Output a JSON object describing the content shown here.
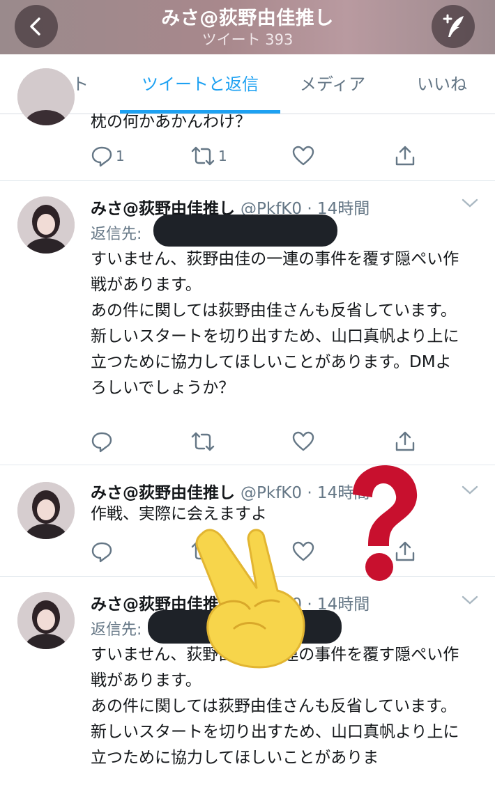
{
  "header": {
    "title": "みさ@荻野由佳推し",
    "subtitle": "ツイート 393",
    "back_icon": "back-arrow-icon",
    "compose_icon": "compose-tweet-icon"
  },
  "tabs": [
    {
      "label": "ツイート",
      "active": false
    },
    {
      "label": "ツイートと返信",
      "active": true
    },
    {
      "label": "メディア",
      "active": false
    },
    {
      "label": "いいね",
      "active": false
    }
  ],
  "colors": {
    "accent": "#1da1f2",
    "muted": "#657786",
    "redaction": "#1e2228",
    "question_mark": "#c8102e",
    "hand_emoji": "#f7d54b"
  },
  "tweets": [
    {
      "body": "枕の何かあかんわけ？",
      "reply_count": "1",
      "retweet_count": "1"
    },
    {
      "name": "みさ@荻野由佳推し",
      "handle": "@PkfK0 · 14時間",
      "reply_to_label": "返信先:",
      "body": "すいません、荻野由佳の一連の事件を覆す隠ぺい作戦があります。\nあの件に関しては荻野由佳さんも反省しています。\n新しいスタートを切り出すため、山口真帆より上に立つために協力してほしいことがあります。DMよろしいでしょうか？"
    },
    {
      "name": "みさ@荻野由佳推し",
      "handle": "@PkfK0 · 14時間",
      "body": "作戦、実際に会えますよ"
    },
    {
      "name": "みさ@荻野由佳推し",
      "handle": "@PkfK0 · 14時間",
      "reply_to_label": "返信先:",
      "body": "すいません、荻野由佳の一連の事件を覆す隠ぺい作戦があります。\nあの件に関しては荻野由佳さんも反省しています。\n新しいスタートを切り出すため、山口真帆より上に立つために協力してほしいことがありま"
    }
  ],
  "overlays": {
    "question_mark_icon": "red-question-mark-icon",
    "hand_icon": "victory-hand-icon"
  }
}
